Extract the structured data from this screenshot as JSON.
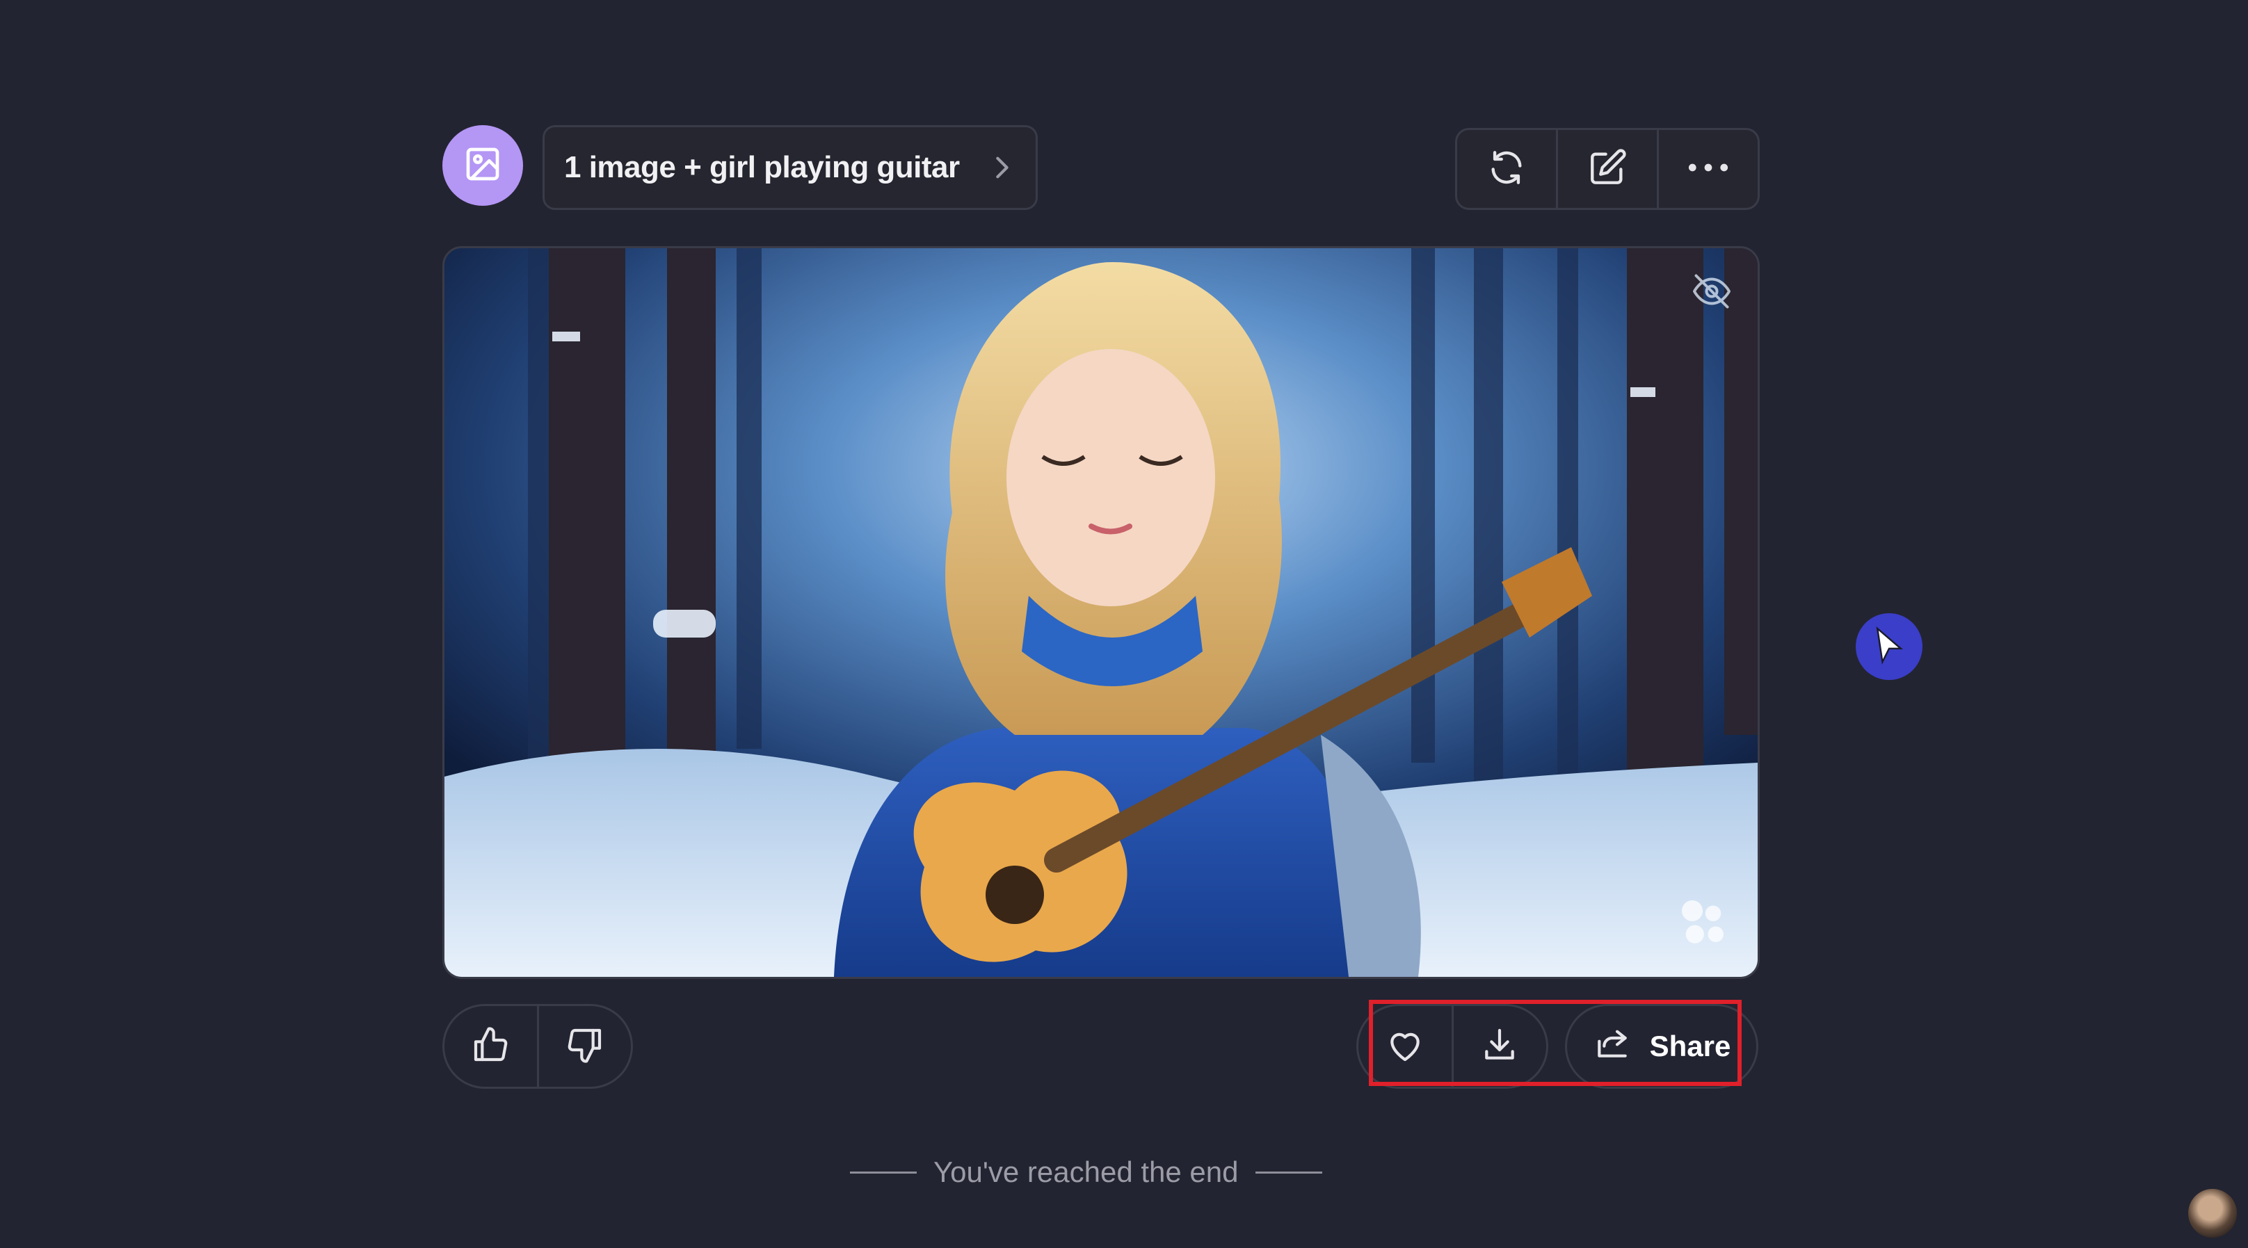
{
  "header": {
    "avatar_icon": "image-icon",
    "prompt_label": "1 image + girl playing guitar",
    "chevron_icon": "chevron-right-icon",
    "toolbar": [
      {
        "icon": "refresh-icon"
      },
      {
        "icon": "edit-icon"
      },
      {
        "icon": "more-icon"
      }
    ]
  },
  "image": {
    "hide_icon": "eye-off-icon",
    "watermark_icon": "logo-icon"
  },
  "feedback": {
    "like_icon": "thumbs-up-icon",
    "dislike_icon": "thumbs-down-icon"
  },
  "actions": {
    "favorite_icon": "heart-icon",
    "download_icon": "download-icon",
    "share_icon": "share-icon",
    "share_label": "Share"
  },
  "footer": {
    "end_text": "You've reached the end"
  },
  "colors": {
    "background": "#232431",
    "avatar": "#b496f5",
    "highlight": "#e0202a",
    "border": "#3a3b48",
    "cursor": "#3a3ec8"
  }
}
